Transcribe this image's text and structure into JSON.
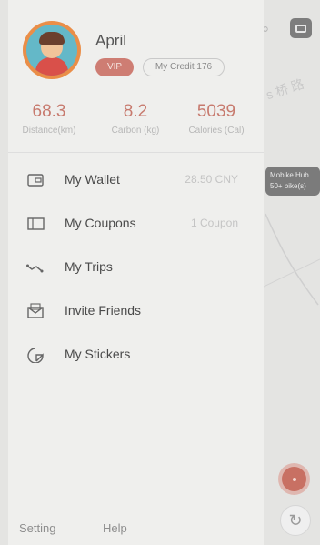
{
  "user": {
    "name": "April",
    "vip_label": "VIP",
    "credit_label": "My Credit 176"
  },
  "stats": [
    {
      "value": "68.3",
      "label": "Distance(km)"
    },
    {
      "value": "8.2",
      "label": "Carbon (kg)"
    },
    {
      "value": "5039",
      "label": "Calories (Cal)"
    }
  ],
  "menu": [
    {
      "icon": "wallet-icon",
      "label": "My Wallet",
      "value": "28.50 CNY"
    },
    {
      "icon": "coupon-icon",
      "label": "My Coupons",
      "value": "1 Coupon"
    },
    {
      "icon": "trips-icon",
      "label": "My Trips",
      "value": ""
    },
    {
      "icon": "envelope-icon",
      "label": "Invite Friends",
      "value": ""
    },
    {
      "icon": "sticker-icon",
      "label": "My Stickers",
      "value": ""
    }
  ],
  "footer": {
    "setting_label": "Setting",
    "help_label": "Help"
  },
  "map": {
    "road_label": "s 桥 路",
    "hub_title": "Mobike Hub",
    "hub_subtitle": "50+ bike(s)"
  },
  "colors": {
    "accent": "#c77a6e",
    "drawer_bg": "#efefed",
    "avatar_ring": "#ea8e48"
  }
}
